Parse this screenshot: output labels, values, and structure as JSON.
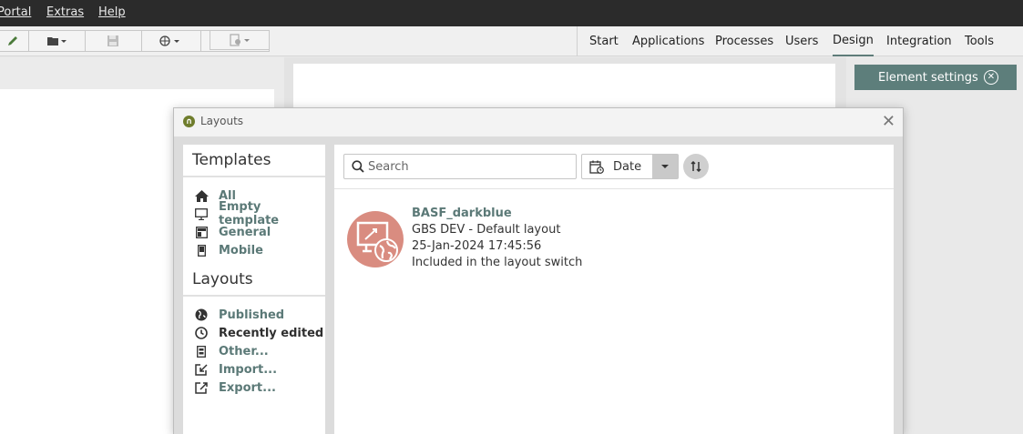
{
  "menu": {
    "items": [
      "Portal",
      "Extras",
      "Help"
    ]
  },
  "nav": {
    "items": [
      "Start",
      "Applications",
      "Processes",
      "Users",
      "Design",
      "Integration",
      "Tools"
    ],
    "active": "Design"
  },
  "element_settings": {
    "label": "Element settings"
  },
  "dialog": {
    "title": "Layouts",
    "templates_title": "Templates",
    "templates": [
      {
        "label": "All",
        "icon": "home-icon"
      },
      {
        "label": "Empty template",
        "icon": "monitor-icon"
      },
      {
        "label": "General",
        "icon": "layout-icon"
      },
      {
        "label": "Mobile",
        "icon": "mobile-icon"
      }
    ],
    "layouts_title": "Layouts",
    "layouts": [
      {
        "label": "Published",
        "icon": "globe-icon"
      },
      {
        "label": "Recently edited",
        "icon": "clock-icon"
      },
      {
        "label": "Other...",
        "icon": "document-icon"
      },
      {
        "label": "Import...",
        "icon": "import-icon"
      },
      {
        "label": "Export...",
        "icon": "export-icon"
      }
    ],
    "search_placeholder": "Search",
    "sort_field": "Date",
    "results": [
      {
        "name": "BASF_darkblue",
        "description": "GBS DEV - Default layout",
        "date": "25-Jan-2024 17:45:56",
        "status": "Included in the layout switch"
      }
    ]
  },
  "colors": {
    "accent": "#5b7977",
    "header": "#2b2b2b",
    "thumb": "#d98c80",
    "element_settings": "#5d7e7b"
  }
}
